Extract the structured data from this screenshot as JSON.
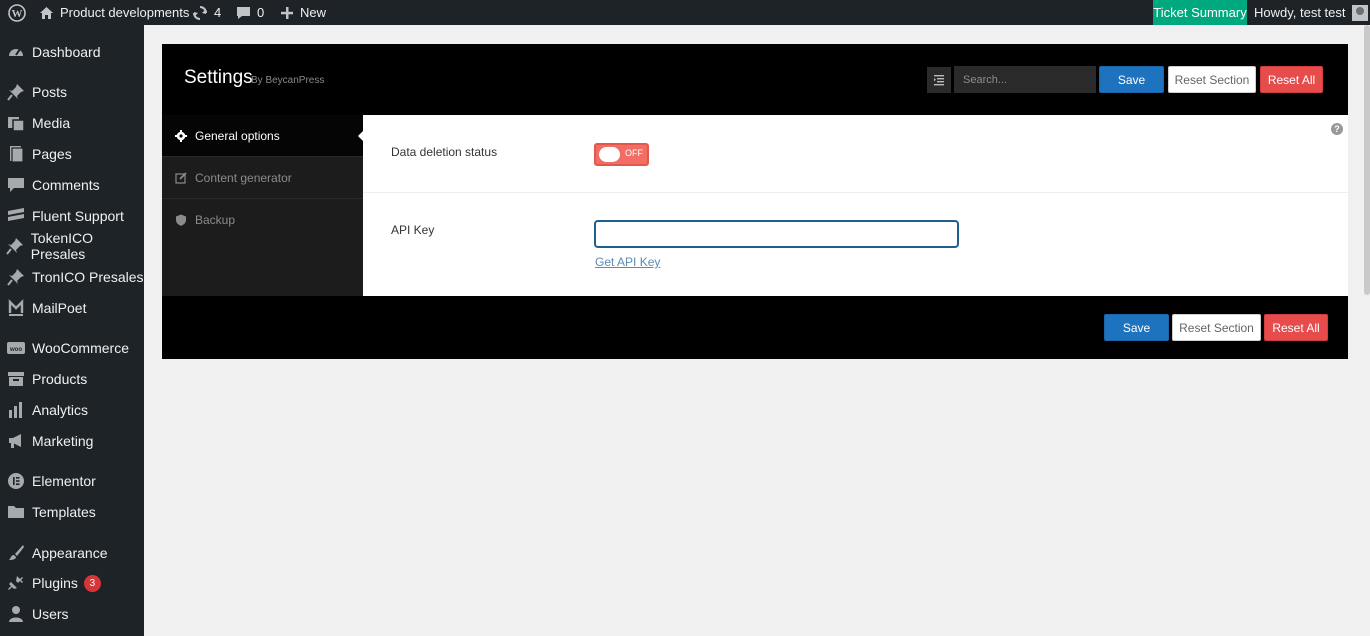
{
  "adminbar": {
    "site_name": "Product developments",
    "updates_count": "4",
    "comments_count": "0",
    "new_label": "New",
    "ticket_summary": "Ticket Summary",
    "howdy": "Howdy, test test"
  },
  "sidebar": {
    "items": [
      {
        "label": "Dashboard",
        "icon": "dashboard-icon"
      },
      {
        "label": "Posts",
        "icon": "pin-icon"
      },
      {
        "label": "Media",
        "icon": "media-icon"
      },
      {
        "label": "Pages",
        "icon": "page-icon"
      },
      {
        "label": "Comments",
        "icon": "comment-icon"
      },
      {
        "label": "Fluent Support",
        "icon": "support-icon"
      },
      {
        "label": "TokenICO Presales",
        "icon": "pin-icon"
      },
      {
        "label": "TronICO Presales",
        "icon": "pin-icon"
      },
      {
        "label": "MailPoet",
        "icon": "mailpoet-icon"
      },
      {
        "label": "WooCommerce",
        "icon": "woo-icon"
      },
      {
        "label": "Products",
        "icon": "archive-icon"
      },
      {
        "label": "Analytics",
        "icon": "chart-icon"
      },
      {
        "label": "Marketing",
        "icon": "megaphone-icon"
      },
      {
        "label": "Elementor",
        "icon": "elementor-icon"
      },
      {
        "label": "Templates",
        "icon": "folder-icon"
      },
      {
        "label": "Appearance",
        "icon": "brush-icon"
      },
      {
        "label": "Plugins",
        "icon": "plugin-icon",
        "badge": "3"
      },
      {
        "label": "Users",
        "icon": "user-icon"
      }
    ]
  },
  "settings": {
    "title": "Settings",
    "byline": "By BeycanPress",
    "search_placeholder": "Search...",
    "save": "Save",
    "reset_section": "Reset Section",
    "reset_all": "Reset All",
    "nav": [
      {
        "label": "General options",
        "icon": "gear-icon"
      },
      {
        "label": "Content generator",
        "icon": "edit-icon"
      },
      {
        "label": "Backup",
        "icon": "shield-icon"
      }
    ],
    "fields": {
      "data_deletion_label": "Data deletion status",
      "toggle_state": "OFF",
      "api_key_label": "API Key",
      "api_key_value": "",
      "get_api_key": "Get API Key"
    }
  }
}
